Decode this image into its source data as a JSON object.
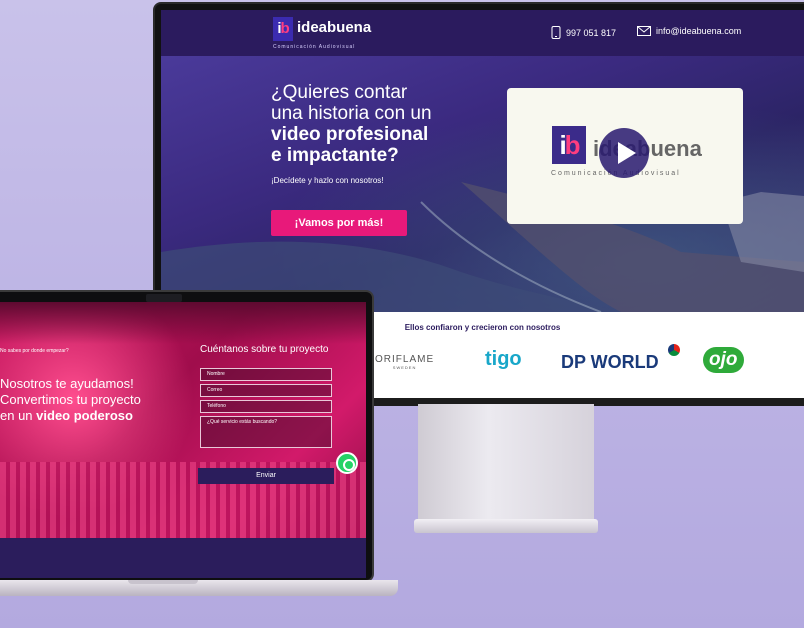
{
  "monitor": {
    "brand": {
      "mark": "ib",
      "name": "ideabuena",
      "tagline": "Comunicación Audiovisual"
    },
    "header": {
      "phone": "997 051 817",
      "email": "info@ideabuena.com",
      "phone_icon": "phone-icon",
      "email_icon": "mail-icon"
    },
    "hero": {
      "title_line1": "¿Quieres contar",
      "title_line2": "una historia con un",
      "title_line3": "video profesional",
      "title_line4": "e impactante?",
      "subtitle": "¡Decídete y hazlo con nosotros!",
      "cta": "¡Vamos por más!"
    },
    "video": {
      "word": "ideabuena",
      "tag": "Comunicación Audiovisual",
      "play_icon": "play-icon"
    },
    "clients": {
      "title": "Ellos confiaron y crecieron con nosotros",
      "logos": [
        "ORIFLAME",
        "tigo",
        "DP WORLD",
        "ojo"
      ],
      "oriflame_sub": "SWEDEN"
    }
  },
  "laptop": {
    "kicker": "No sabes por donde empezar?",
    "headline_line1": "Nosotros te ayudamos!",
    "headline_line2": "Convertimos tu proyecto",
    "headline_line3_prefix": "en un ",
    "headline_line3_bold": "video poderoso",
    "form": {
      "title": "Cuéntanos sobre tu proyecto",
      "fields": [
        "Nombre",
        "Correo",
        "Teléfono",
        "¿Qué servicio estás buscando?"
      ],
      "submit": "Enviar"
    }
  },
  "colors": {
    "brand_purple": "#2b1b5e",
    "accent_pink": "#e8197a",
    "whatsapp": "#25d366"
  }
}
